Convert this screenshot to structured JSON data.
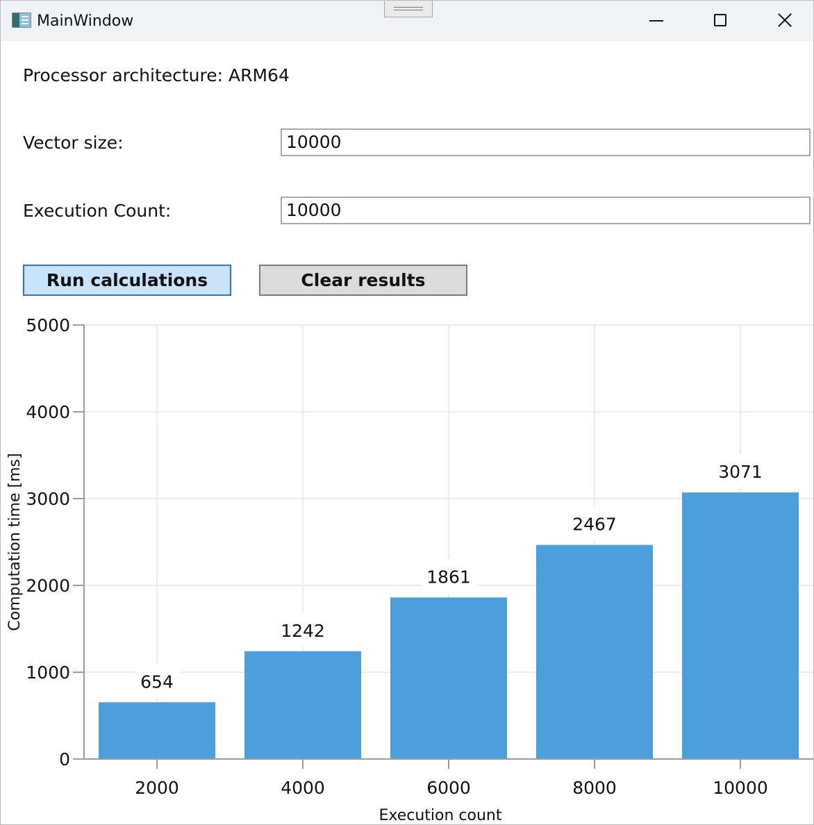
{
  "window": {
    "title": "MainWindow"
  },
  "form": {
    "processor_label": "Processor architecture: ARM64",
    "vector_size_label": "Vector size:",
    "vector_size_value": "10000",
    "execution_count_label": "Execution Count:",
    "execution_count_value": "10000",
    "run_button": "Run calculations",
    "clear_button": "Clear results"
  },
  "colors": {
    "bar": "#4d9fdc",
    "grid": "#ececec",
    "axis": "#9a9a9a"
  },
  "chart_data": {
    "type": "bar",
    "categories": [
      "2000",
      "4000",
      "6000",
      "8000",
      "10000"
    ],
    "values": [
      654,
      1242,
      1861,
      2467,
      3071
    ],
    "data_labels": [
      "654",
      "1242",
      "1861",
      "2467",
      "3071"
    ],
    "ylim": [
      0,
      5000
    ],
    "yticks": [
      "0",
      "1000",
      "2000",
      "3000",
      "4000",
      "5000"
    ],
    "xlabel": "Execution count",
    "ylabel": "Computation time [ms]",
    "grid": true,
    "legend": "none"
  }
}
